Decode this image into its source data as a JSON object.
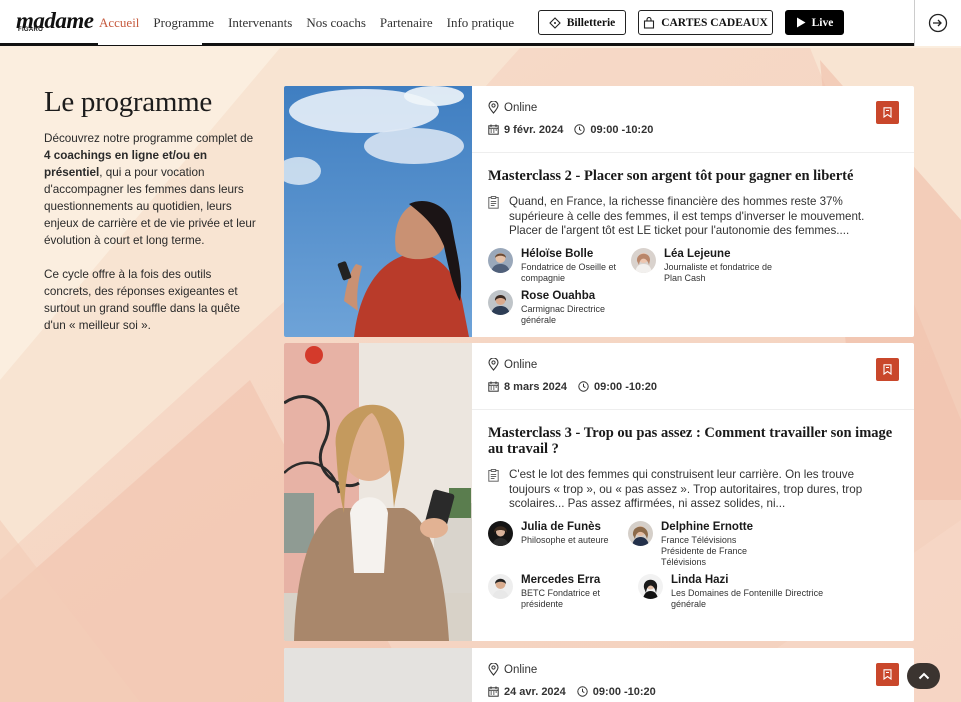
{
  "header": {
    "logo": "madame",
    "logo_sub": "FIGARO",
    "nav": [
      "Accueil",
      "Programme",
      "Intervenants",
      "Nos coachs",
      "Partenaire",
      "Info pratique"
    ],
    "active_nav": "Accueil",
    "billetterie_label": "Billetterie",
    "gift_label": "CARTES CADEAUX",
    "live_label": "Live"
  },
  "intro": {
    "title": "Le programme",
    "p1_a": "Découvrez notre programme complet de ",
    "p1_bold": "4 coachings en ligne et/ou en présentiel",
    "p1_b": ", qui a pour vocation d'accompagner les femmes dans leurs questionnements au quotidien, leurs enjeux de carrière et de vie privée et leur évolution à court et long terme.",
    "p2": "Ce cycle offre à la fois des outils concrets, des réponses exigeantes et surtout un grand souffle dans la quête d'un « meilleur soi »."
  },
  "cards": [
    {
      "location": "Online",
      "date": "9 févr. 2024",
      "time": "09:00 -10:20",
      "title": "Masterclass 2 - Placer son argent tôt pour gagner en liberté",
      "description": "Quand, en France, la richesse financière des hommes reste 37% supérieure à celle des femmes, il est temps d'inverser le mouvement. Placer de l'argent tôt est LE ticket pour l'autonomie des femmes....",
      "speakers": [
        {
          "name": "Héloïse Bolle",
          "role": "Fondatrice de Oseille et compagnie"
        },
        {
          "name": "Léa Lejeune",
          "role": "Journaliste et fondatrice de Plan Cash"
        },
        {
          "name": "Rose Ouahba",
          "role": "Carmignac Directrice générale"
        }
      ]
    },
    {
      "location": "Online",
      "date": "8 mars 2024",
      "time": "09:00 -10:20",
      "title": "Masterclass 3 - Trop ou pas assez : Comment travailler son image au travail ?",
      "description": "C'est le lot des femmes qui construisent leur carrière. On les trouve toujours « trop », ou « pas assez ». Trop autoritaires, trop dures, trop scolaires... Pas assez affirmées, ni assez solides, ni...",
      "speakers": [
        {
          "name": "Julia de Funès",
          "role": "Philosophe et auteure"
        },
        {
          "name": "Delphine Ernotte",
          "role": "France Télévisions Présidente de France Télévisions"
        },
        {
          "name": "Mercedes Erra",
          "role": "BETC Fondatrice et présidente"
        },
        {
          "name": "Linda Hazi",
          "role": "Les Domaines de Fontenille Directrice générale"
        }
      ]
    },
    {
      "location": "Online",
      "date": "24 avr. 2024",
      "time": "09:00 -10:20"
    }
  ],
  "colors": {
    "accent": "#c65a3e",
    "bookmark": "#c9472b",
    "background": "#fbeedf"
  }
}
